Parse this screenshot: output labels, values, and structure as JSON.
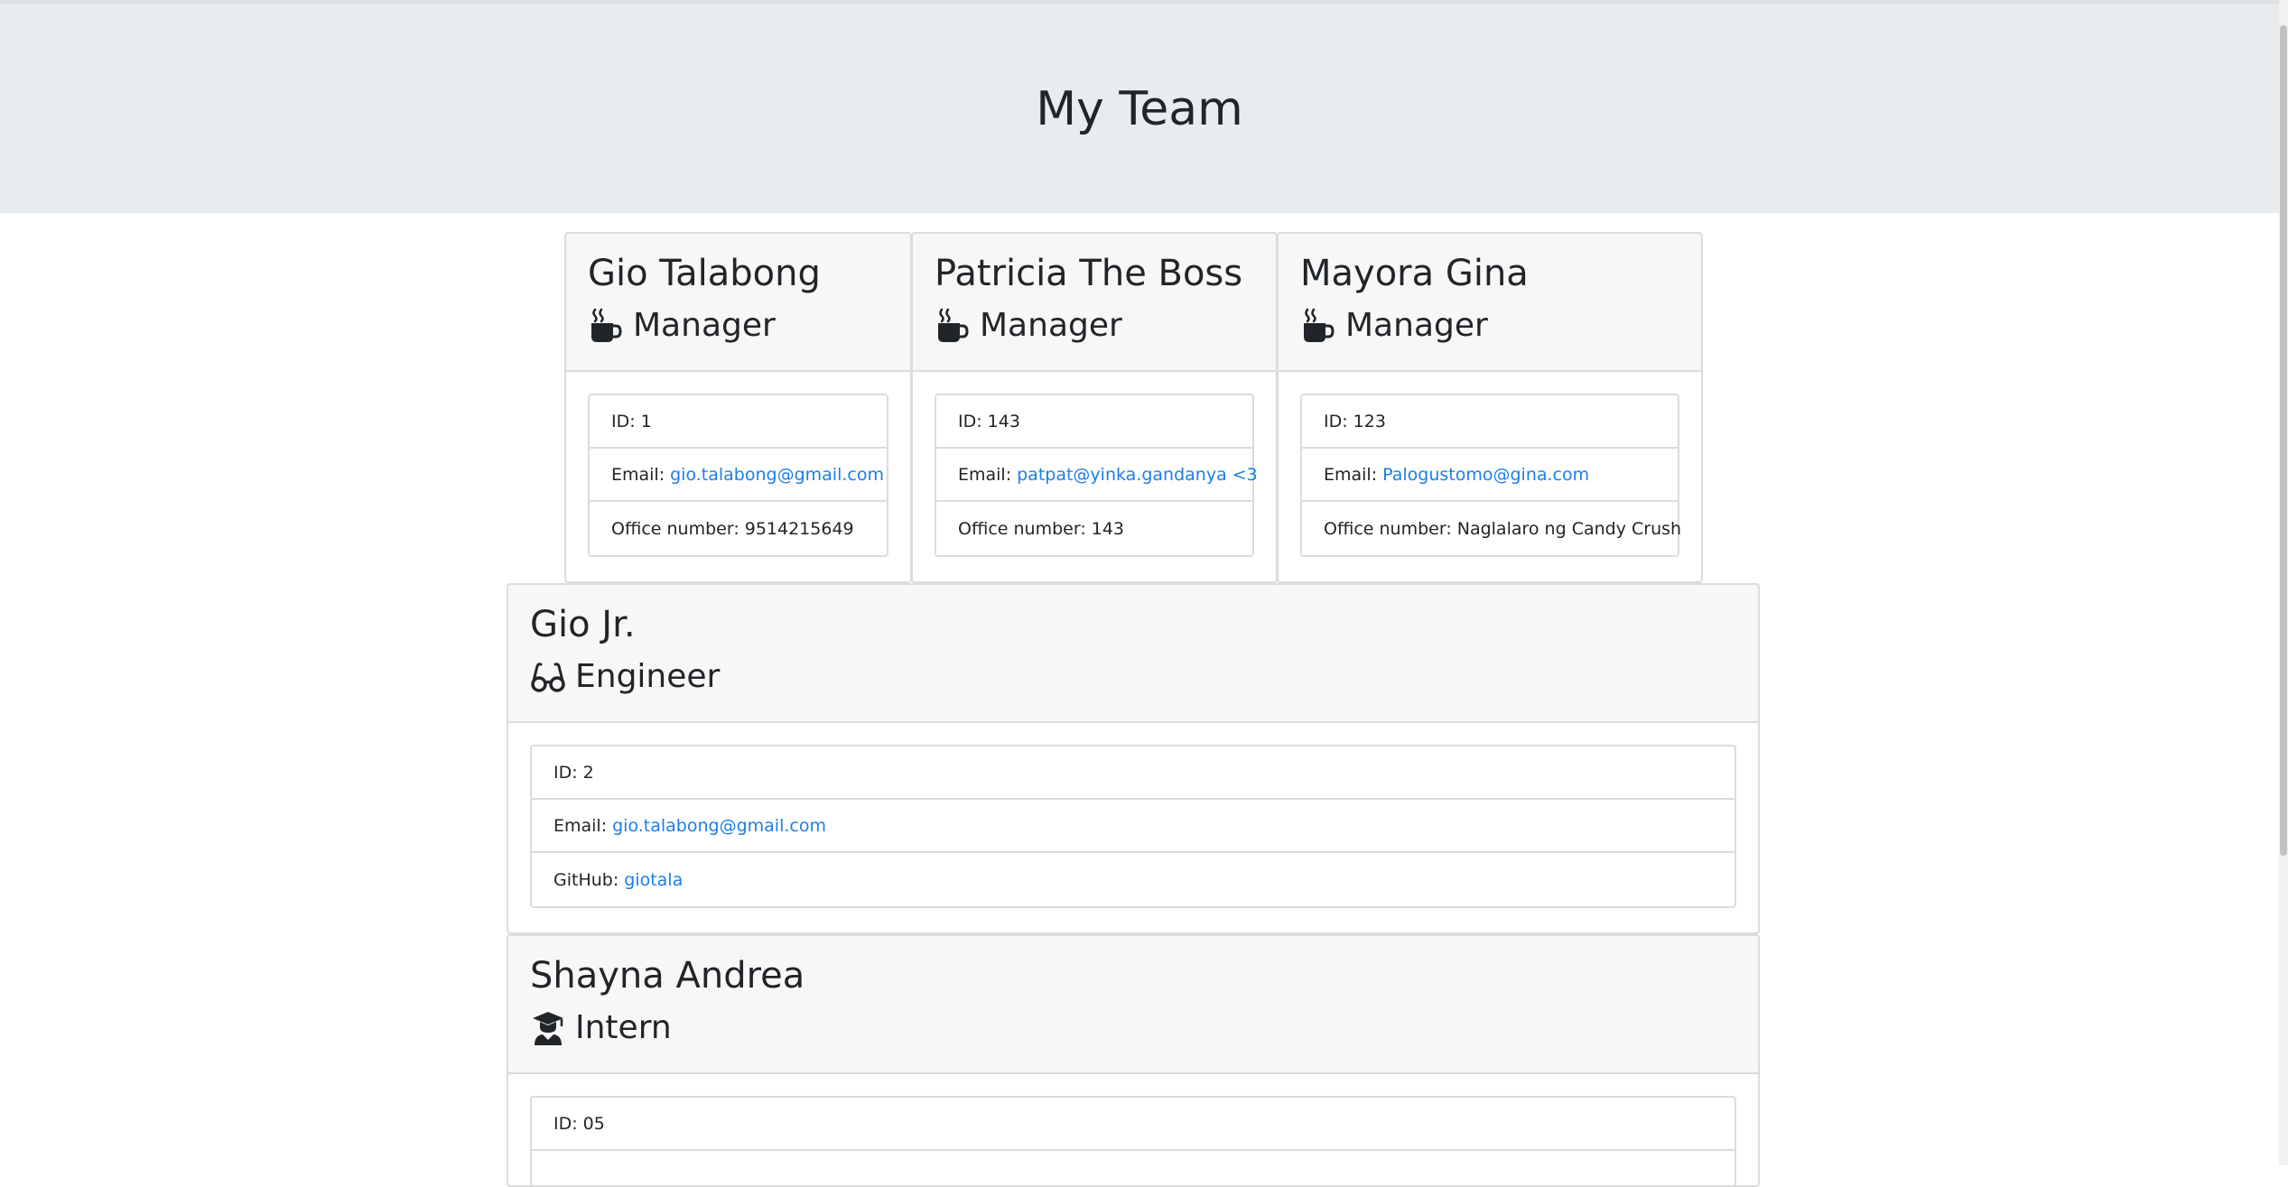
{
  "header": {
    "title": "My Team"
  },
  "managers": [
    {
      "name": "Gio Talabong",
      "role": "Manager",
      "role_icon": "mug-hot-icon",
      "id_label": "ID:",
      "id": "1",
      "email_label": "Email:",
      "email": "gio.talabong@gmail.com",
      "office_label": "Office number:",
      "office": "9514215649"
    },
    {
      "name": "Patricia The Boss",
      "role": "Manager",
      "role_icon": "mug-hot-icon",
      "id_label": "ID:",
      "id": "143",
      "email_label": "Email:",
      "email": "patpat@yinka.gandanya <3",
      "office_label": "Office number:",
      "office": "143"
    },
    {
      "name": "Mayora Gina",
      "role": "Manager",
      "role_icon": "mug-hot-icon",
      "id_label": "ID:",
      "id": "123",
      "email_label": "Email:",
      "email": "Palogustomo@gina.com",
      "office_label": "Office number:",
      "office": "Naglalaro ng Candy Crush"
    }
  ],
  "engineer": {
    "name": "Gio Jr.",
    "role": "Engineer",
    "role_icon": "glasses-icon",
    "id_label": "ID:",
    "id": "2",
    "email_label": "Email:",
    "email": "gio.talabong@gmail.com",
    "github_label": "GitHub:",
    "github": "giotala"
  },
  "intern": {
    "name": "Shayna Andrea",
    "role": "Intern",
    "role_icon": "graduate-icon",
    "id_label": "ID:",
    "id": "05"
  },
  "colors": {
    "link": "#1d7ee8",
    "header_bg": "#e9ecef",
    "card_header_bg": "#f7f7f7"
  }
}
